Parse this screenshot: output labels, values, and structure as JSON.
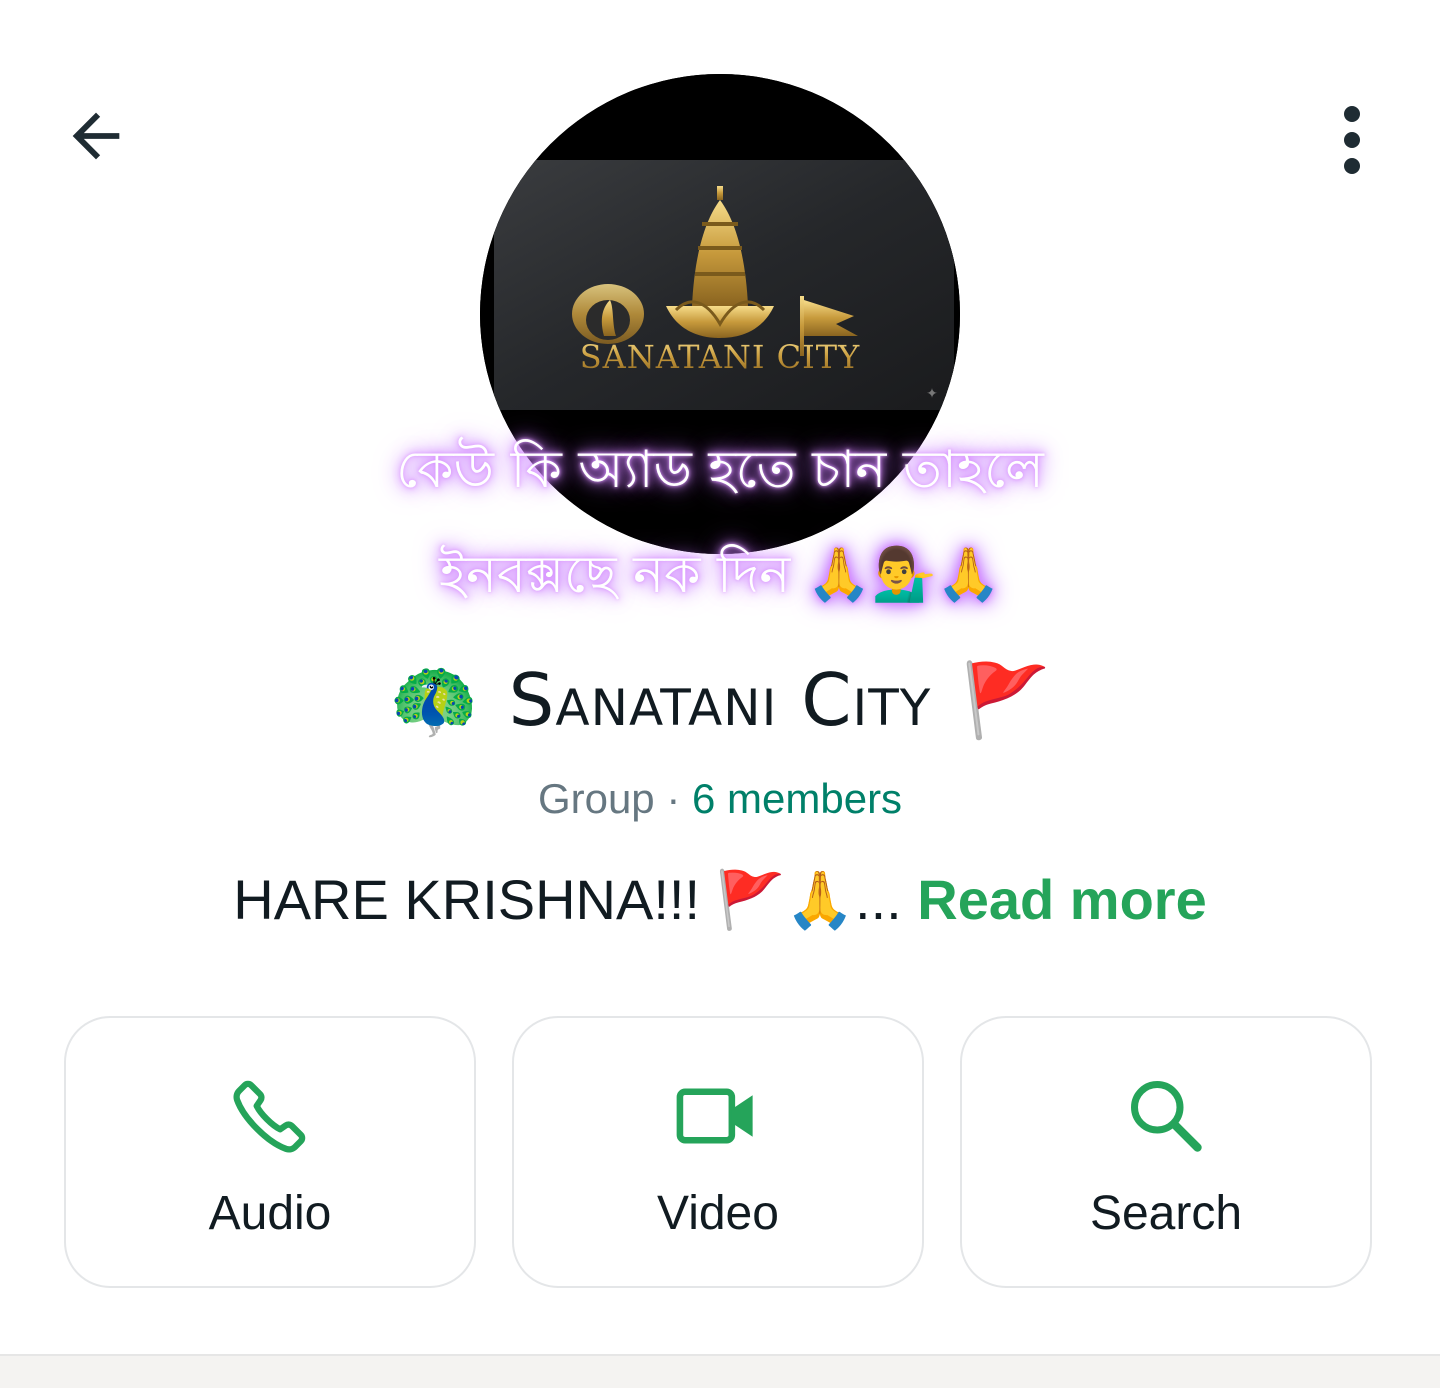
{
  "header": {
    "back_icon": "arrow-left-icon",
    "more_icon": "more-vertical-icon"
  },
  "avatar": {
    "logo_text": "SANATANI CITY"
  },
  "overlay": {
    "line1": "কেউ কি অ্যাড হতে চান তাহলে",
    "line2": "ইনবক্সছে নক দিন 🙏💁‍♂️🙏"
  },
  "group": {
    "name": "Sanatani City",
    "prefix_emoji": "🦚",
    "suffix_emoji": "🚩",
    "type_label": "Group",
    "separator": " · ",
    "members": "6 members"
  },
  "description": {
    "text": "HARE KRISHNA!!! 🚩🙏...",
    "read_more": "Read more"
  },
  "actions": [
    {
      "label": "Audio",
      "icon": "phone-icon"
    },
    {
      "label": "Video",
      "icon": "video-camera-icon"
    },
    {
      "label": "Search",
      "icon": "search-icon"
    }
  ],
  "colors": {
    "accent_green": "#25a45a",
    "members_green": "#008069",
    "text_primary": "#111b21",
    "text_secondary": "#667781",
    "glow_purple": "#c77dff"
  }
}
